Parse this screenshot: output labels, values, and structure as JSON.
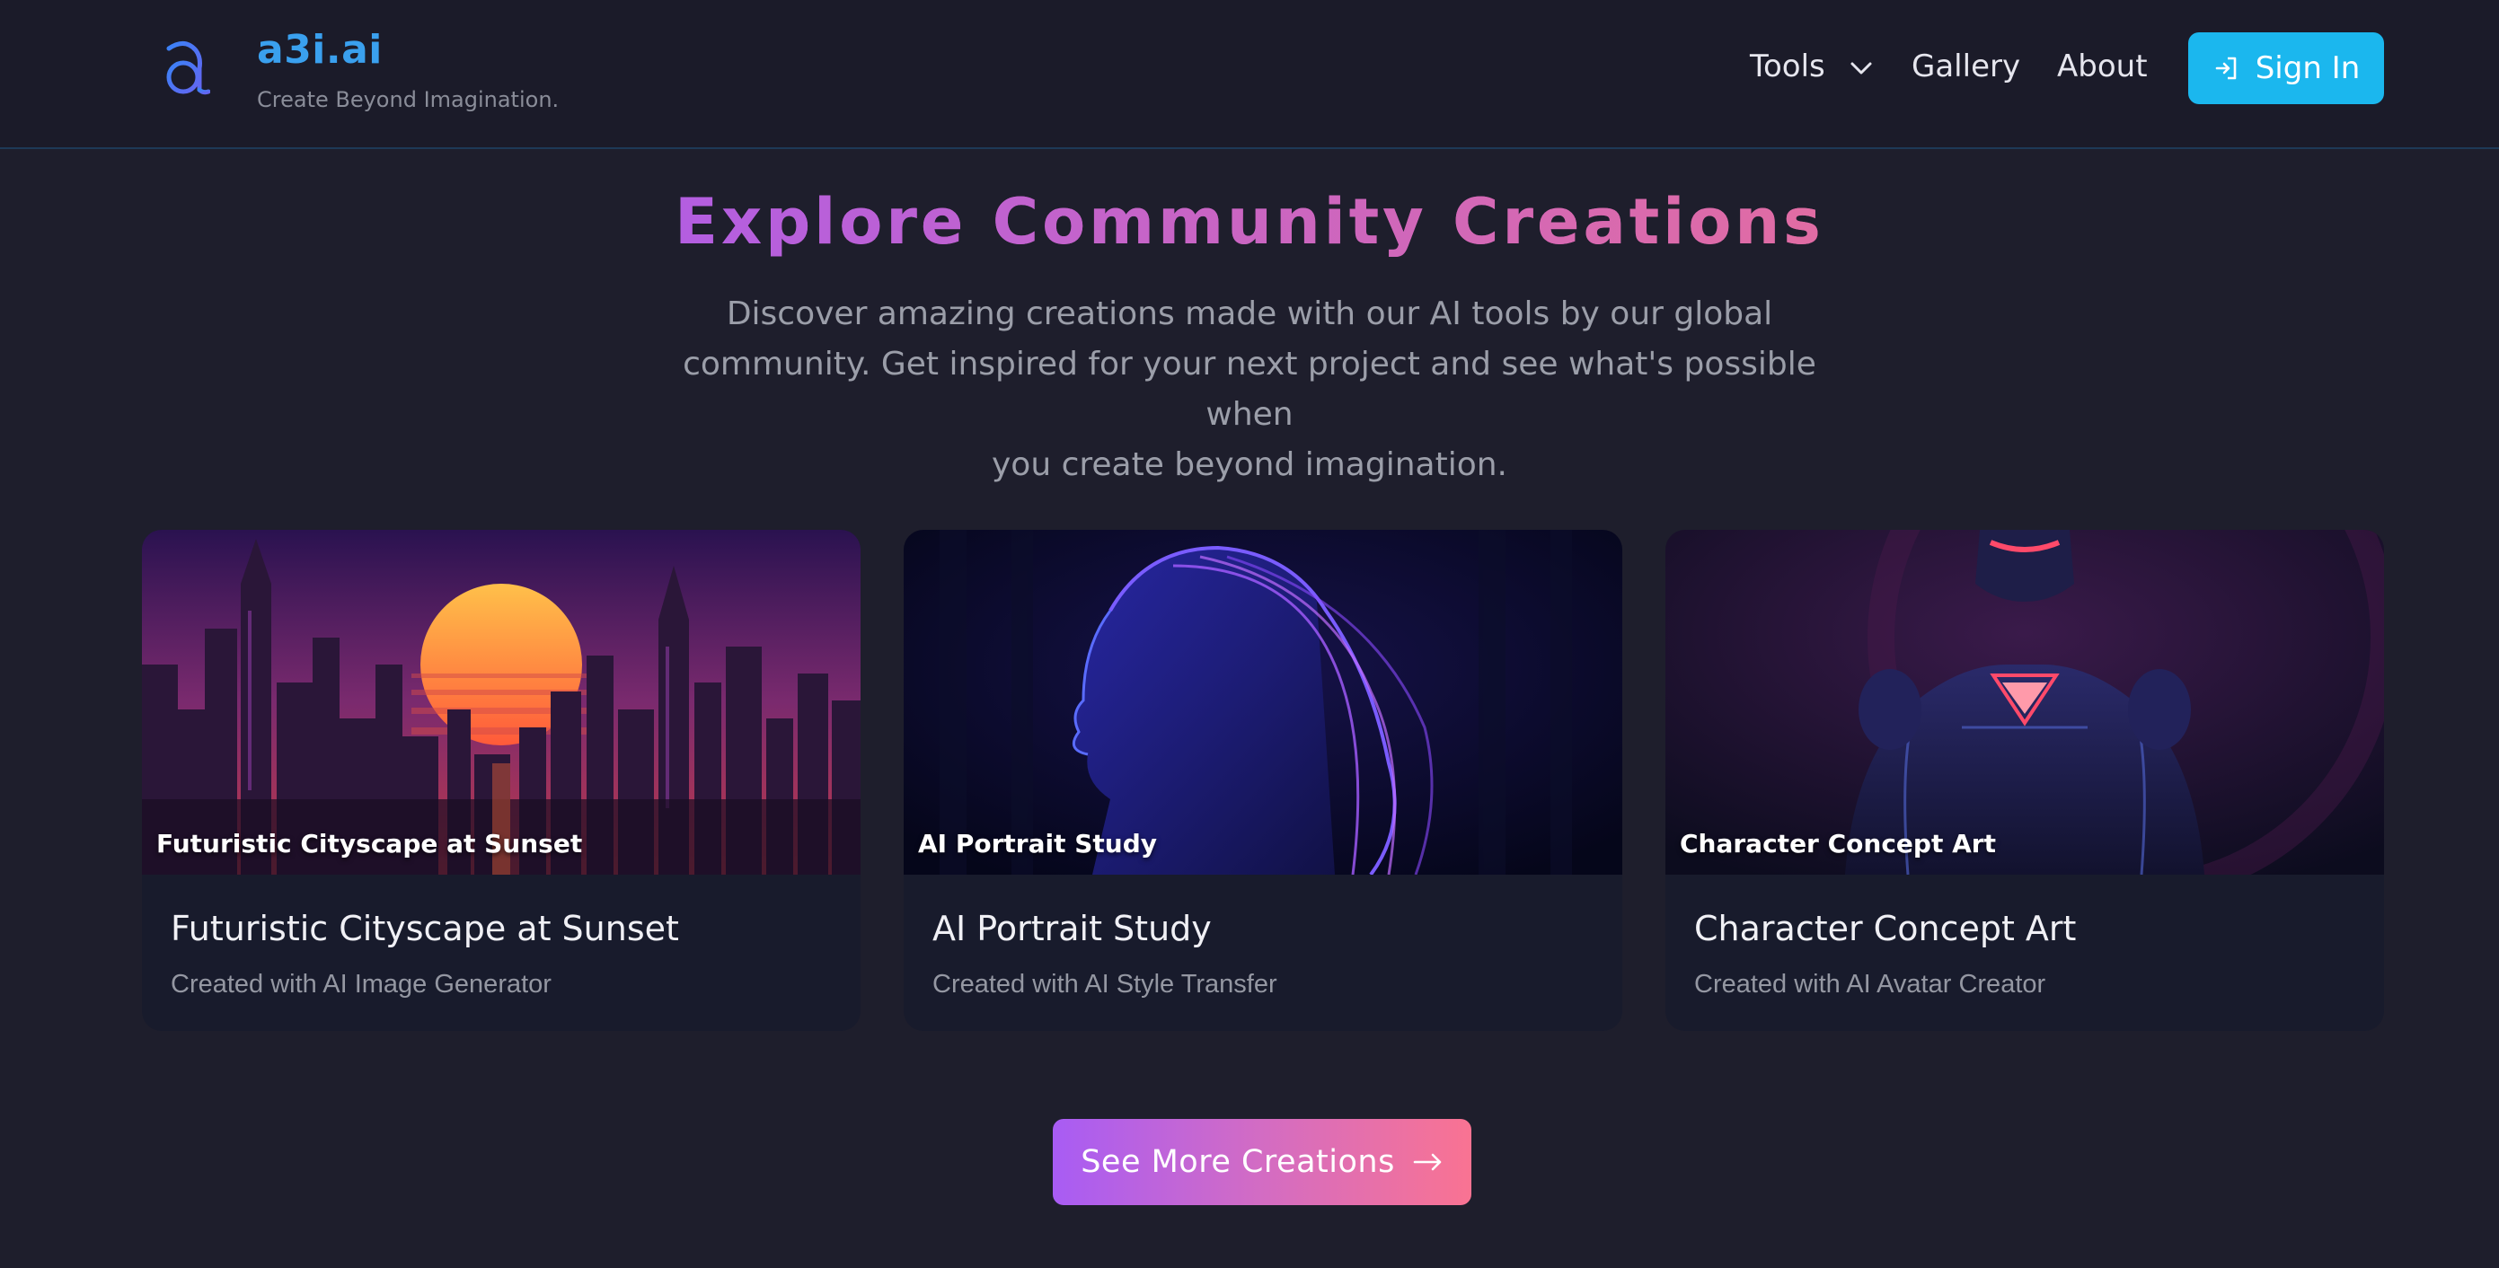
{
  "header": {
    "brand_name": "a3i.ai",
    "tagline": "Create Beyond Imagination.",
    "nav": {
      "tools": "Tools",
      "gallery": "Gallery",
      "about": "About"
    },
    "sign_in": "Sign In"
  },
  "hero": {
    "title": "Explore Community Creations",
    "subtitle_lines": [
      "Discover amazing creations made with our AI tools by our global",
      "community. Get inspired for your next project and see what's possible when",
      "you create beyond imagination."
    ]
  },
  "cards": [
    {
      "caption": "Futuristic Cityscape at Sunset",
      "title": "Futuristic Cityscape at Sunset",
      "subtitle": "Created with AI Image Generator"
    },
    {
      "caption": "AI Portrait Study",
      "title": "AI Portrait Study",
      "subtitle": "Created with AI Style Transfer"
    },
    {
      "caption": "Character Concept Art",
      "title": "Character Concept Art",
      "subtitle": "Created with AI Avatar Creator"
    }
  ],
  "cta": {
    "label": "See More Creations"
  },
  "colors": {
    "background": "#1e1e2c",
    "header": "#1b1b29",
    "brand": "#3aa0ee",
    "sign_in": "#1bb7ee",
    "card": "#181b2c",
    "cta_start": "#a85cf4",
    "cta_end": "#f97392"
  },
  "icons": {
    "logo": "a-logo-icon",
    "tools_dropdown": "chevron-down-icon",
    "sign_in": "login-arrow-icon",
    "cta": "arrow-right-icon"
  }
}
